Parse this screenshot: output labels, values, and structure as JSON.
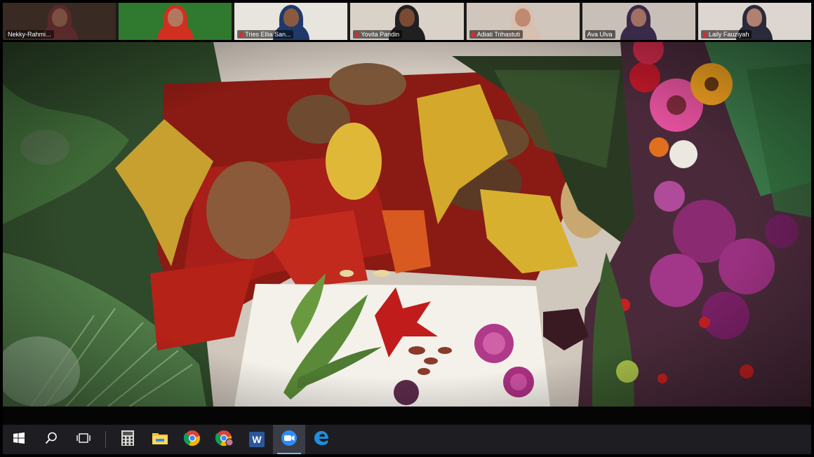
{
  "participants": [
    {
      "name": "Nekky-Rahmi...",
      "muted": false,
      "bg": "#3a2a24",
      "skin": "#7a5040",
      "clothes": "#5a2a2a"
    },
    {
      "name": "",
      "muted": false,
      "bg": "#2f7a2f",
      "skin": "#b07860",
      "clothes": "#d03020"
    },
    {
      "name": "Tries Ellia San...",
      "muted": true,
      "bg": "#e8e4de",
      "skin": "#8a5a40",
      "clothes": "#1f3a6a"
    },
    {
      "name": "Yovita Pandin",
      "muted": true,
      "bg": "#d8d2c8",
      "skin": "#7a4a32",
      "clothes": "#202020"
    },
    {
      "name": "Adiati Trihastuti",
      "muted": true,
      "bg": "#d0c6bc",
      "skin": "#c08a70",
      "clothes": "#d8c0b0"
    },
    {
      "name": "Ava Ulva",
      "muted": false,
      "bg": "#c8bfb8",
      "skin": "#a07060",
      "clothes": "#3a2a4a"
    },
    {
      "name": "Laily Fauziyah",
      "muted": true,
      "bg": "#ddd6d0",
      "skin": "#b08070",
      "clothes": "#2a2a3a"
    }
  ],
  "taskbar": {
    "items": [
      {
        "id": "start",
        "name": "windows-start-icon"
      },
      {
        "id": "search",
        "name": "search-icon"
      },
      {
        "id": "taskview",
        "name": "task-view-icon"
      },
      {
        "id": "calculator",
        "name": "calculator-icon"
      },
      {
        "id": "explorer",
        "name": "file-explorer-icon"
      },
      {
        "id": "chrome",
        "name": "chrome-icon"
      },
      {
        "id": "chrome2",
        "name": "chrome-profile-icon"
      },
      {
        "id": "word",
        "name": "word-icon",
        "label": "W"
      },
      {
        "id": "zoom",
        "name": "zoom-icon",
        "active": true
      },
      {
        "id": "edge",
        "name": "edge-icon"
      }
    ]
  },
  "colors": {
    "taskbar": "#1e1e22",
    "zoom_blue": "#2d8cff",
    "muted_mic": "#e02828"
  }
}
